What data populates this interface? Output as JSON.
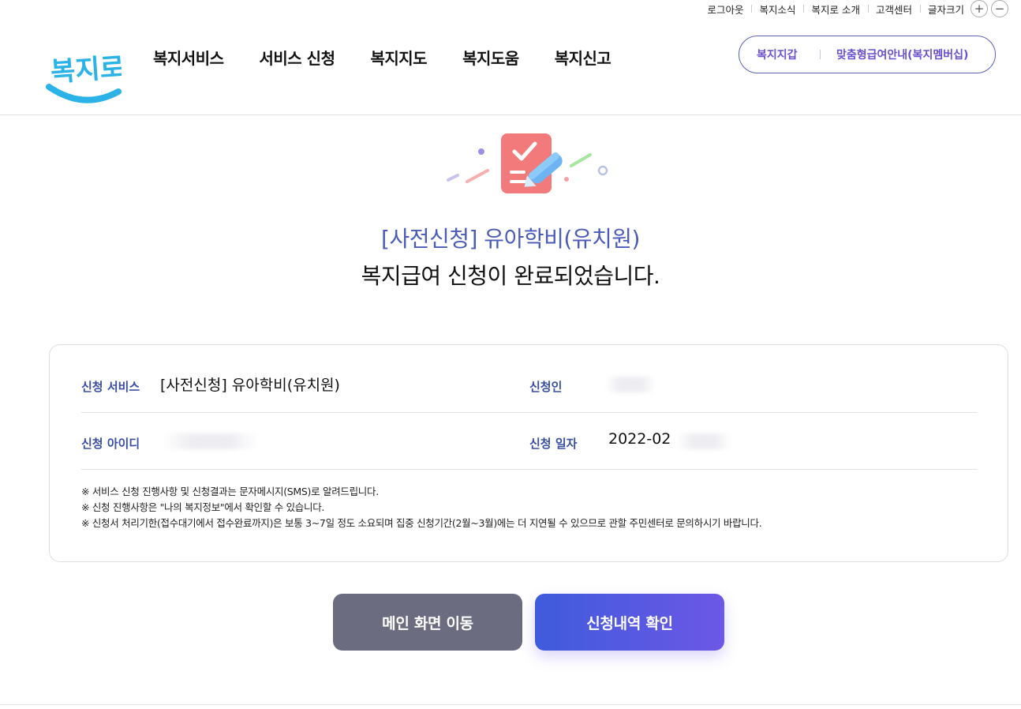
{
  "util_bar": {
    "links": [
      "로그아웃",
      "복지소식",
      "복지로 소개",
      "고객센터"
    ],
    "font_size_label": "글자크기",
    "increase_symbol": "+",
    "decrease_symbol": "−"
  },
  "header": {
    "logo_text": "복지로",
    "nav": [
      "복지서비스",
      "서비스 신청",
      "복지지도",
      "복지도움",
      "복지신고"
    ],
    "wallet_link": "복지지갑",
    "membership_link": "맞춤형급여안내(복지멤버십)"
  },
  "hero": {
    "icon": "checklist-pen-icon",
    "service_title": "[사전신청] 유아학비(유치원)",
    "complete_message": "복지급여 신청이 완료되었습니다."
  },
  "details": {
    "service_label": "신청 서비스",
    "service_value": "[사전신청] 유아학비(유치원)",
    "applicant_label": "신청인",
    "id_label": "신청 아이디",
    "date_label": "신청 일자",
    "date_value": "2022-02",
    "notes": [
      "※ 서비스 신청 진행사항 및 신청결과는 문자메시지(SMS)로 알려드립니다.",
      "※ 신청 진행사항은 \"나의 복지정보\"에서 확인할 수 있습니다.",
      "※ 신청서 처리기한(접수대기에서 접수완료까지)은 보통 3~7일 정도 소요되며 집중 신청기간(2월~3월)에는 더 지연될 수 있으므로 관할 주민센터로 문의하시기 바랍니다."
    ]
  },
  "buttons": {
    "main": "메인 화면 이동",
    "check": "신청내역 확인"
  },
  "colors": {
    "accent_blue": "#4a5bb8",
    "label_blue": "#3a4fa3",
    "button_gray": "#6c6c80",
    "button_gradient_start": "#3f5bdc",
    "button_gradient_end": "#6c57e6",
    "icon_red": "#f47a7a"
  }
}
